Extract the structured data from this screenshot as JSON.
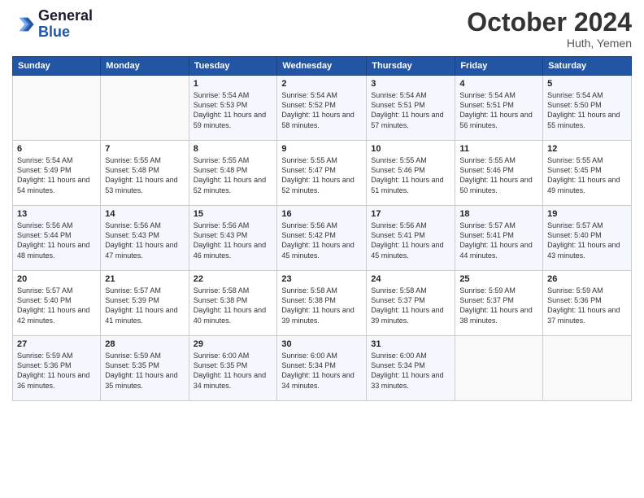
{
  "header": {
    "logo_line1": "General",
    "logo_line2": "Blue",
    "month": "October 2024",
    "location": "Huth, Yemen"
  },
  "weekdays": [
    "Sunday",
    "Monday",
    "Tuesday",
    "Wednesday",
    "Thursday",
    "Friday",
    "Saturday"
  ],
  "weeks": [
    [
      {
        "day": "",
        "info": ""
      },
      {
        "day": "",
        "info": ""
      },
      {
        "day": "1",
        "info": "Sunrise: 5:54 AM\nSunset: 5:53 PM\nDaylight: 11 hours and 59 minutes."
      },
      {
        "day": "2",
        "info": "Sunrise: 5:54 AM\nSunset: 5:52 PM\nDaylight: 11 hours and 58 minutes."
      },
      {
        "day": "3",
        "info": "Sunrise: 5:54 AM\nSunset: 5:51 PM\nDaylight: 11 hours and 57 minutes."
      },
      {
        "day": "4",
        "info": "Sunrise: 5:54 AM\nSunset: 5:51 PM\nDaylight: 11 hours and 56 minutes."
      },
      {
        "day": "5",
        "info": "Sunrise: 5:54 AM\nSunset: 5:50 PM\nDaylight: 11 hours and 55 minutes."
      }
    ],
    [
      {
        "day": "6",
        "info": "Sunrise: 5:54 AM\nSunset: 5:49 PM\nDaylight: 11 hours and 54 minutes."
      },
      {
        "day": "7",
        "info": "Sunrise: 5:55 AM\nSunset: 5:48 PM\nDaylight: 11 hours and 53 minutes."
      },
      {
        "day": "8",
        "info": "Sunrise: 5:55 AM\nSunset: 5:48 PM\nDaylight: 11 hours and 52 minutes."
      },
      {
        "day": "9",
        "info": "Sunrise: 5:55 AM\nSunset: 5:47 PM\nDaylight: 11 hours and 52 minutes."
      },
      {
        "day": "10",
        "info": "Sunrise: 5:55 AM\nSunset: 5:46 PM\nDaylight: 11 hours and 51 minutes."
      },
      {
        "day": "11",
        "info": "Sunrise: 5:55 AM\nSunset: 5:46 PM\nDaylight: 11 hours and 50 minutes."
      },
      {
        "day": "12",
        "info": "Sunrise: 5:55 AM\nSunset: 5:45 PM\nDaylight: 11 hours and 49 minutes."
      }
    ],
    [
      {
        "day": "13",
        "info": "Sunrise: 5:56 AM\nSunset: 5:44 PM\nDaylight: 11 hours and 48 minutes."
      },
      {
        "day": "14",
        "info": "Sunrise: 5:56 AM\nSunset: 5:43 PM\nDaylight: 11 hours and 47 minutes."
      },
      {
        "day": "15",
        "info": "Sunrise: 5:56 AM\nSunset: 5:43 PM\nDaylight: 11 hours and 46 minutes."
      },
      {
        "day": "16",
        "info": "Sunrise: 5:56 AM\nSunset: 5:42 PM\nDaylight: 11 hours and 45 minutes."
      },
      {
        "day": "17",
        "info": "Sunrise: 5:56 AM\nSunset: 5:41 PM\nDaylight: 11 hours and 45 minutes."
      },
      {
        "day": "18",
        "info": "Sunrise: 5:57 AM\nSunset: 5:41 PM\nDaylight: 11 hours and 44 minutes."
      },
      {
        "day": "19",
        "info": "Sunrise: 5:57 AM\nSunset: 5:40 PM\nDaylight: 11 hours and 43 minutes."
      }
    ],
    [
      {
        "day": "20",
        "info": "Sunrise: 5:57 AM\nSunset: 5:40 PM\nDaylight: 11 hours and 42 minutes."
      },
      {
        "day": "21",
        "info": "Sunrise: 5:57 AM\nSunset: 5:39 PM\nDaylight: 11 hours and 41 minutes."
      },
      {
        "day": "22",
        "info": "Sunrise: 5:58 AM\nSunset: 5:38 PM\nDaylight: 11 hours and 40 minutes."
      },
      {
        "day": "23",
        "info": "Sunrise: 5:58 AM\nSunset: 5:38 PM\nDaylight: 11 hours and 39 minutes."
      },
      {
        "day": "24",
        "info": "Sunrise: 5:58 AM\nSunset: 5:37 PM\nDaylight: 11 hours and 39 minutes."
      },
      {
        "day": "25",
        "info": "Sunrise: 5:59 AM\nSunset: 5:37 PM\nDaylight: 11 hours and 38 minutes."
      },
      {
        "day": "26",
        "info": "Sunrise: 5:59 AM\nSunset: 5:36 PM\nDaylight: 11 hours and 37 minutes."
      }
    ],
    [
      {
        "day": "27",
        "info": "Sunrise: 5:59 AM\nSunset: 5:36 PM\nDaylight: 11 hours and 36 minutes."
      },
      {
        "day": "28",
        "info": "Sunrise: 5:59 AM\nSunset: 5:35 PM\nDaylight: 11 hours and 35 minutes."
      },
      {
        "day": "29",
        "info": "Sunrise: 6:00 AM\nSunset: 5:35 PM\nDaylight: 11 hours and 34 minutes."
      },
      {
        "day": "30",
        "info": "Sunrise: 6:00 AM\nSunset: 5:34 PM\nDaylight: 11 hours and 34 minutes."
      },
      {
        "day": "31",
        "info": "Sunrise: 6:00 AM\nSunset: 5:34 PM\nDaylight: 11 hours and 33 minutes."
      },
      {
        "day": "",
        "info": ""
      },
      {
        "day": "",
        "info": ""
      }
    ]
  ]
}
